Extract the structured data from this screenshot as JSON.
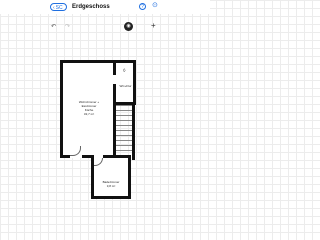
{
  "header": {
    "back_label": "SC",
    "back_chevron": "‹",
    "title": "Erdgeschoss",
    "help_glyph": "?",
    "more_glyph": "⊙"
  },
  "toolbar": {
    "undo_glyph": "↶",
    "redo_glyph": "↷",
    "mode_glyph": "◉",
    "add_glyph": "+"
  },
  "rooms": {
    "kitchen": {
      "label_1": "Wohnzimmer +",
      "label_2": "Esszimmer",
      "label_3": "Küche",
      "label_4": "32,7 m²"
    },
    "hallway": {
      "label": "WC+Flur"
    },
    "bathroom": {
      "label": "Badezimmer",
      "sublabel": "3,8 m²"
    }
  },
  "icons": {
    "hallway_icon": "sink-icon",
    "hallway_icon_glyph": "◊"
  }
}
